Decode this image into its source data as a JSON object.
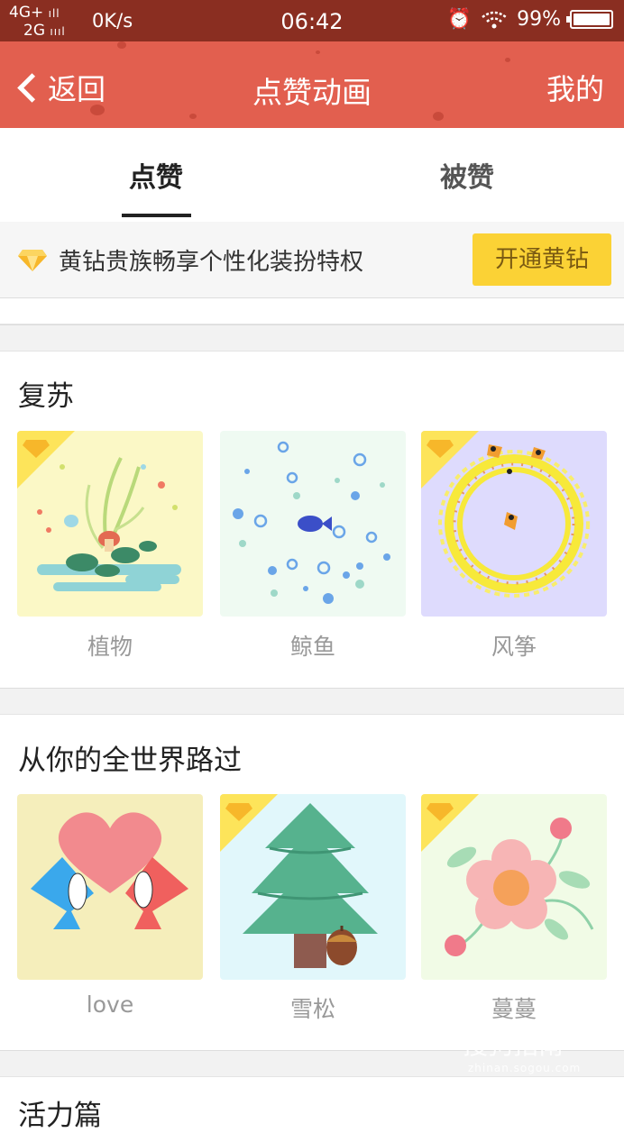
{
  "status_bar": {
    "network_top": "4G+",
    "network_bottom": "2G",
    "speed": "0K/s",
    "time": "06:42",
    "battery": "99%",
    "battery_level": 0.99
  },
  "nav": {
    "back_label": "返回",
    "title": "点赞动画",
    "mine_label": "我的",
    "color": "#e25f4f"
  },
  "tabs": [
    {
      "label": "点赞",
      "active": true
    },
    {
      "label": "被赞",
      "active": false
    }
  ],
  "vip": {
    "text": "黄钻贵族畅享个性化装扮特权",
    "button": "开通黄钻",
    "button_color": "#fbd235"
  },
  "sections": [
    {
      "title": "复苏",
      "items": [
        {
          "name": "植物",
          "vip": true,
          "icon": "plant-icon",
          "bg": "#fbf8c6"
        },
        {
          "name": "鲸鱼",
          "vip": false,
          "icon": "whale-icon",
          "bg": "#effaf2"
        },
        {
          "name": "风筝",
          "vip": true,
          "icon": "kite-icon",
          "bg": "#dedbfd"
        }
      ]
    },
    {
      "title": "从你的全世界路过",
      "items": [
        {
          "name": "love",
          "vip": false,
          "icon": "love-icon",
          "bg": "#f5eebb"
        },
        {
          "name": "雪松",
          "vip": true,
          "icon": "cedar-icon",
          "bg": "#e1f7fb"
        },
        {
          "name": "蔓蔓",
          "vip": true,
          "icon": "flower-icon",
          "bg": "#f1fbe6"
        }
      ]
    }
  ],
  "next_section_partial": "活力篇",
  "watermark": {
    "text": "搜狗指南",
    "sub": "zhinan.sogou.com"
  }
}
